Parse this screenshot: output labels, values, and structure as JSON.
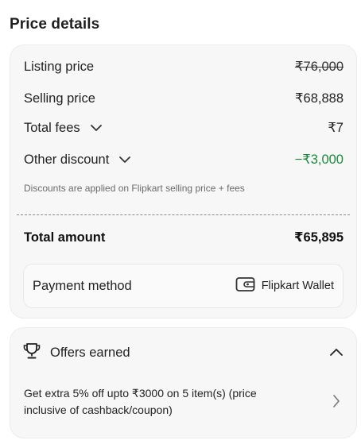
{
  "page": {
    "title": "Price details"
  },
  "price_details": {
    "listing_price": {
      "label": "Listing price",
      "value": "₹76,000"
    },
    "selling_price": {
      "label": "Selling price",
      "value": "₹68,888"
    },
    "total_fees": {
      "label": "Total fees",
      "value": "₹7"
    },
    "other_discount": {
      "label": "Other discount",
      "value": "−₹3,000"
    },
    "note": "Discounts are applied on Flipkart selling price + fees",
    "total_amount": {
      "label": "Total amount",
      "value": "₹65,895"
    },
    "payment": {
      "label": "Payment method",
      "method": "Flipkart Wallet",
      "icon": "wallet-icon"
    }
  },
  "offers": {
    "title": "Offers earned",
    "icon": "trophy-icon",
    "offer_text": "Get extra 5% off upto ₹3000 on 5 item(s) (price inclusive of cashback/coupon)"
  },
  "colors": {
    "discount_green": "#1a8a3c",
    "card_bg": "#f7f7f7"
  }
}
